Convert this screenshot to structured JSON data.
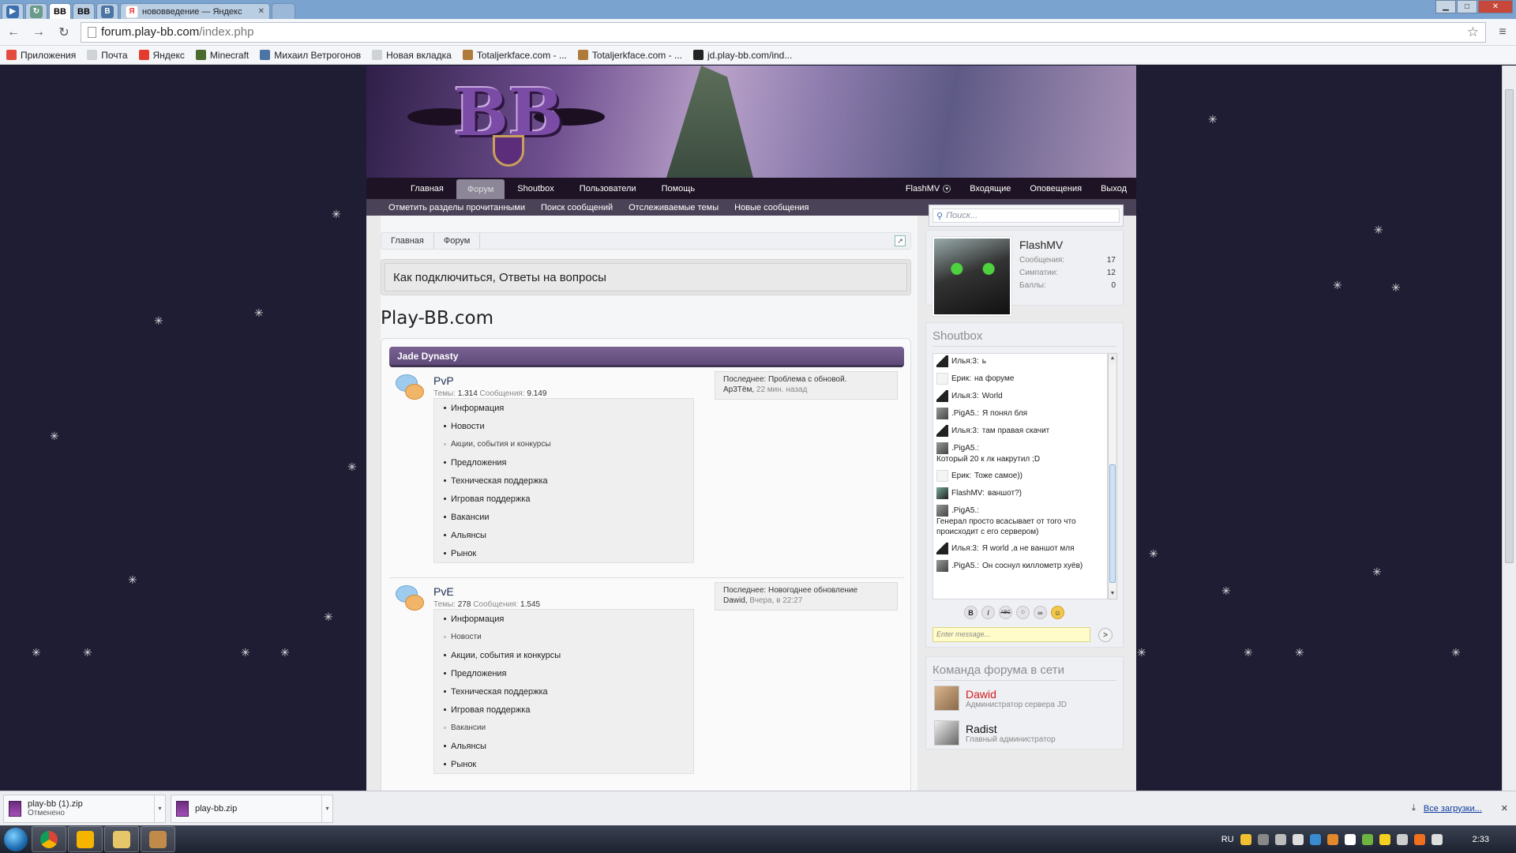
{
  "browser": {
    "tabs": [
      {
        "label": "",
        "icon": "play-icon"
      },
      {
        "label": "",
        "icon": "refresh-icon"
      },
      {
        "label": "BB",
        "icon": "bb-icon",
        "active": true
      },
      {
        "label": "BB",
        "icon": "bb-icon"
      },
      {
        "label": "B",
        "icon": "vk-icon"
      },
      {
        "label": "нововведение — Яндекс",
        "icon": "yandex-icon"
      }
    ],
    "url_host": "forum.play-bb.com",
    "url_path": "/index.php",
    "bookmarks": [
      {
        "label": "Приложения",
        "icon": "apps-icon",
        "color": "#e34b3c"
      },
      {
        "label": "Почта",
        "icon": "page-icon",
        "color": "#cfd3d8"
      },
      {
        "label": "Яндекс",
        "icon": "yandex-icon",
        "color": "#e33b2e"
      },
      {
        "label": "Minecraft",
        "icon": "minecraft-icon",
        "color": "#4a6a2e"
      },
      {
        "label": "Михаил Ветрогонов",
        "icon": "vk-icon",
        "color": "#4c75a3"
      },
      {
        "label": "Новая вкладка",
        "icon": "page-icon",
        "color": "#cfd3d8"
      },
      {
        "label": "Totaljerkface.com - ...",
        "icon": "tjf-icon",
        "color": "#b07a3a"
      },
      {
        "label": "Totaljerkface.com - ...",
        "icon": "tjf-icon",
        "color": "#b07a3a"
      },
      {
        "label": "jd.play-bb.com/ind...",
        "icon": "bb-icon",
        "color": "#222222"
      }
    ]
  },
  "site": {
    "nav": [
      "Главная",
      "Форум",
      "Shoutbox",
      "Пользователи",
      "Помощь"
    ],
    "nav_active_index": 1,
    "nav_right": {
      "user": "FlashMV",
      "inbox": "Входящие",
      "alerts": "Оповещения",
      "logout": "Выход"
    },
    "subnav": [
      "Отметить разделы прочитанными",
      "Поиск сообщений",
      "Отслеживаемые темы",
      "Новые сообщения"
    ],
    "search_placeholder": "Поиск...",
    "breadcrumb": [
      "Главная",
      "Форум"
    ],
    "notice": "Как подключиться, Ответы на вопросы",
    "site_title": "Play-BB.com",
    "category": "Jade Dynasty",
    "nodes": [
      {
        "title": "PvP",
        "threads_label": "Темы:",
        "threads": "1.314",
        "posts_label": "Сообщения:",
        "posts": "9.149",
        "subforums": [
          {
            "label": "Информация",
            "light": false
          },
          {
            "label": "Новости",
            "light": false
          },
          {
            "label": "Акции, события и конкурсы",
            "light": true
          },
          {
            "label": "Предложения",
            "light": false
          },
          {
            "label": "Техническая поддержка",
            "light": false
          },
          {
            "label": "Игровая поддержка",
            "light": false
          },
          {
            "label": "Вакансии",
            "light": false
          },
          {
            "label": "Альянсы",
            "light": false
          },
          {
            "label": "Рынок",
            "light": false
          }
        ],
        "last_label": "Последнее:",
        "last_title": "Проблема с обновой.",
        "last_user": "Ар3Тём",
        "last_time": "22 мин. назад"
      },
      {
        "title": "PvE",
        "threads_label": "Темы:",
        "threads": "278",
        "posts_label": "Сообщения:",
        "posts": "1.545",
        "subforums": [
          {
            "label": "Информация",
            "light": false
          },
          {
            "label": "Новости",
            "light": true
          },
          {
            "label": "Акции, события и конкурсы",
            "light": false
          },
          {
            "label": "Предложения",
            "light": false
          },
          {
            "label": "Техническая поддержка",
            "light": false
          },
          {
            "label": "Игровая поддержка",
            "light": false
          },
          {
            "label": "Вакансии",
            "light": true
          },
          {
            "label": "Альянсы",
            "light": false
          },
          {
            "label": "Рынок",
            "light": false
          }
        ],
        "last_label": "Последнее:",
        "last_title": "Новогоднее обновление",
        "last_user": "Dawid",
        "last_time": "Вчера, в 22:27"
      }
    ],
    "visitor": {
      "name": "FlashMV",
      "messages_label": "Сообщения:",
      "messages": "17",
      "likes_label": "Симпатии:",
      "likes": "12",
      "points_label": "Баллы:",
      "points": "0"
    },
    "shoutbox": {
      "title": "Shoutbox",
      "messages": [
        {
          "user": "Илья:3:",
          "text": "ь",
          "avatar": "dark"
        },
        {
          "user": "Ерик:",
          "text": "на форуме",
          "avatar": "blank"
        },
        {
          "user": "Илья:3:",
          "text": "World",
          "avatar": "dark"
        },
        {
          "user": ".PigA5.:",
          "text": "Я понял бля",
          "avatar": "grey"
        },
        {
          "user": "Илья:3:",
          "text": "там правая скачит",
          "avatar": "dark"
        },
        {
          "user": ".PigA5.:",
          "text": "Который 20 к лк накрутил ;D",
          "avatar": "grey",
          "wrap": true
        },
        {
          "user": "Ерик:",
          "text": "Тоже самое))",
          "avatar": "blank"
        },
        {
          "user": "FlashMV:",
          "text": "ваншот?)",
          "avatar": "cat"
        },
        {
          "user": ".PigA5.:",
          "text": "Генерал просто всасывает от того что происходит с его сервером)",
          "avatar": "grey",
          "wrap": true
        },
        {
          "user": "Илья:3:",
          "text": "Я world ,а не ваншот мля",
          "avatar": "dark"
        },
        {
          "user": ".PigA5.:",
          "text": "Он соснул киллометр хуёв)",
          "avatar": "grey"
        }
      ],
      "format_buttons": [
        "B",
        "I",
        "ABC",
        "⁘",
        "∞",
        "☺"
      ],
      "input_placeholder": "Enter message...",
      "send": ">"
    },
    "staff": {
      "title": "Команда форума в сети",
      "members": [
        {
          "name": "Dawid",
          "role": "Администратор сервера JD",
          "color": "#d21b1b"
        },
        {
          "name": "Radist",
          "role": "Главный администратор",
          "color": "#111111"
        }
      ]
    }
  },
  "downloads": {
    "items": [
      {
        "name": "play-bb (1).zip",
        "status": "Отменено"
      },
      {
        "name": "play-bb.zip",
        "status": ""
      }
    ],
    "all": "Все загрузки..."
  },
  "taskbar": {
    "lang": "RU",
    "time": "2:33"
  }
}
